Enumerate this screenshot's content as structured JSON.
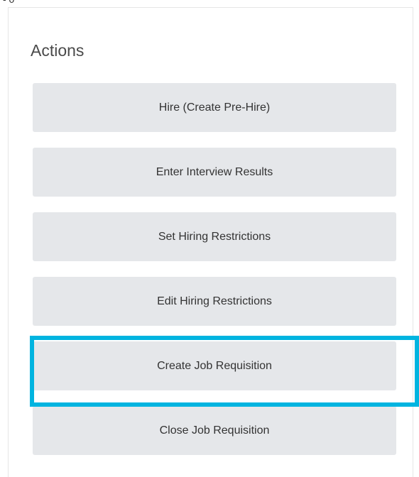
{
  "top_glyph": "- 0",
  "panel": {
    "title": "Actions"
  },
  "actions": [
    {
      "label": "Hire (Create Pre-Hire)"
    },
    {
      "label": "Enter Interview Results"
    },
    {
      "label": "Set Hiring Restrictions"
    },
    {
      "label": "Edit Hiring Restrictions"
    },
    {
      "label": "Create Job Requisition",
      "highlighted": true
    },
    {
      "label": "Close Job Requisition"
    }
  ],
  "colors": {
    "button_bg": "#e5e7ea",
    "highlight": "#00b4e0",
    "text": "#333333"
  }
}
